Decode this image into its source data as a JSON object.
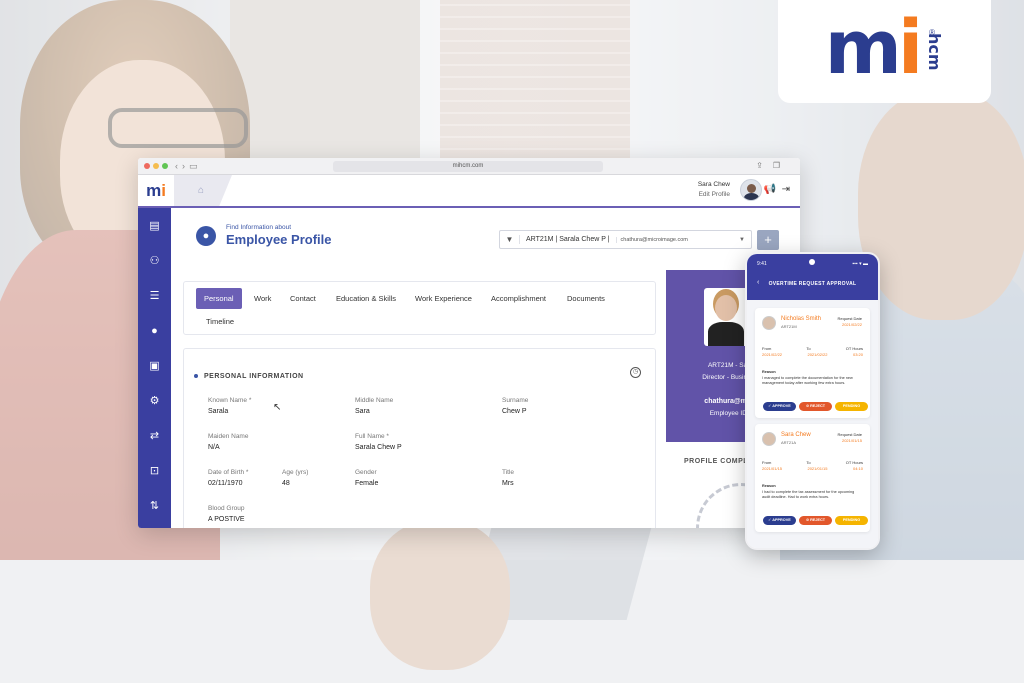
{
  "brand": {
    "logo_m": "m",
    "logo_i": "i",
    "logo_hcm": "hcm",
    "registered": "®",
    "colors": {
      "navy": "#2b3d8f",
      "orange": "#f47b20",
      "purple": "#6b5fb5",
      "sidebar": "#3a3fa0"
    }
  },
  "browser": {
    "url": "mihcm.com",
    "app_logo_m": "m",
    "app_logo_i": "i",
    "home_icon": "home-icon"
  },
  "user": {
    "name": "Sara Chew",
    "edit_label": "Edit Profile"
  },
  "page": {
    "subtitle": "Find Information about",
    "title": "Employee Profile"
  },
  "selector": {
    "employee": "ART21M | Sarala Chew P |",
    "email": "chathura@microimage.com",
    "add_label": "+"
  },
  "tabs": [
    {
      "label": "Personal",
      "active": true
    },
    {
      "label": "Work"
    },
    {
      "label": "Contact"
    },
    {
      "label": "Education & Skills"
    },
    {
      "label": "Work Experience"
    },
    {
      "label": "Accomplishment"
    },
    {
      "label": "Documents"
    },
    {
      "label": "Timeline"
    }
  ],
  "personal": {
    "section_title": "PERSONAL INFORMATION",
    "fields": {
      "known_name": {
        "label": "Known Name *",
        "value": "Sarala"
      },
      "middle_name": {
        "label": "Middle Name",
        "value": "Sara"
      },
      "surname": {
        "label": "Surname",
        "value": "Chew P"
      },
      "maiden_name": {
        "label": "Maiden Name",
        "value": "N/A"
      },
      "full_name": {
        "label": "Full Name *",
        "value": "Sarala Chew P"
      },
      "dob": {
        "label": "Date of Birth *",
        "value": "02/11/1970"
      },
      "age": {
        "label": "Age (yrs)",
        "value": "48"
      },
      "gender": {
        "label": "Gender",
        "value": "Female"
      },
      "title": {
        "label": "Title",
        "value": "Mrs"
      },
      "blood_group": {
        "label": "Blood Group",
        "value": "A POSTIVE"
      }
    }
  },
  "profile_panel": {
    "line1": "ART21M - Sarala",
    "line2": "Director - Business D",
    "email": "chathura@microi",
    "employee_id": "Employee ID : A",
    "completion_label": "PROFILE COMPL"
  },
  "phone": {
    "time": "9:41",
    "signal": "▪▪▪ ▾ ▬",
    "title": "OVERTIME REQUEST APPROVAL",
    "requests": [
      {
        "name": "Nicholas Smith",
        "id": "ART21M",
        "request_date_label": "Request Date",
        "request_date": "2021/02/22",
        "from_label": "From",
        "from": "2021/02/22",
        "to_label": "To",
        "to": "2021/02/22",
        "ot_label": "OT Hours",
        "ot": "03:20",
        "reason_label": "Reason",
        "reason": "I managed to complete the documentation for the new management today after working few extra hours.",
        "approve": "✓ APPROVE",
        "reject": "⊘ REJECT",
        "pending": "PENDING"
      },
      {
        "name": "Sara Chew",
        "id": "ART21A",
        "request_date_label": "Request Date",
        "request_date": "2021/01/15",
        "from_label": "From",
        "from": "2021/01/15",
        "to_label": "To",
        "to": "2021/01/15",
        "ot_label": "OT Hours",
        "ot": "04:10",
        "reason_label": "Reason",
        "reason": "I had to complete the tax assessment for the upcoming audit deadline. Had to work extra hours.",
        "approve": "✓ APPROVE",
        "reject": "⊘ REJECT",
        "pending": "PENDING"
      }
    ]
  }
}
